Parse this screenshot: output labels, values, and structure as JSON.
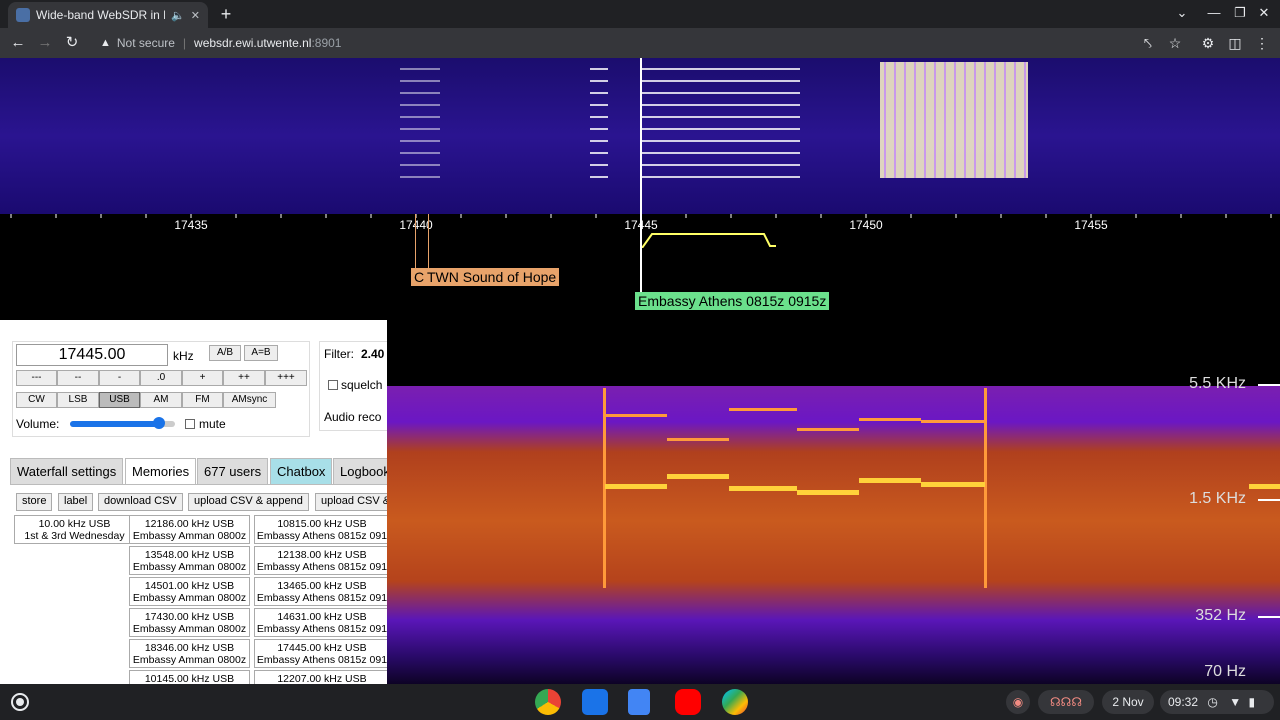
{
  "browser": {
    "tab_title": "Wide-band WebSDR in Ensch",
    "new_tab": "+",
    "security": "Not secure",
    "url_host": "websdr.ewi.utwente.nl",
    "url_port": ":8901"
  },
  "scale": {
    "ticks": [
      "17435",
      "17440",
      "17445",
      "17450",
      "17455"
    ]
  },
  "stations": {
    "c_label": "C",
    "twn": "TWN Sound of Hope",
    "embassy": "Embassy Athens 0815z 0915z"
  },
  "controls": {
    "frequency": "17445.00",
    "unit": "kHz",
    "ab": "A/B",
    "a_eq_b": "A=B",
    "steps": [
      "---",
      "--",
      "-",
      ".0",
      "+",
      "++",
      "+++"
    ],
    "modes": [
      "CW",
      "LSB",
      "USB",
      "AM",
      "FM",
      "AMsync"
    ],
    "active_mode": "USB",
    "volume_label": "Volume:",
    "volume_level": 0.85,
    "mute": "mute",
    "filter_label": "Filter:",
    "filter_value": "2.40",
    "squelch": "squelch",
    "audio_rec": "Audio reco"
  },
  "tabs": [
    "Waterfall settings",
    "Memories",
    "677 users",
    "Chatbox",
    "Logbook"
  ],
  "memory_buttons": [
    "store",
    "label",
    "download CSV",
    "upload CSV & append",
    "upload CSV &"
  ],
  "memories": {
    "col1": [
      {
        "f": "10.00 kHz USB",
        "n": "1st & 3rd Wednesday"
      }
    ],
    "col2": [
      {
        "f": "12186.00 kHz USB",
        "n": "Embassy Amman 0800z"
      },
      {
        "f": "13548.00 kHz USB",
        "n": "Embassy Amman 0800z"
      },
      {
        "f": "14501.00 kHz USB",
        "n": "Embassy Amman 0800z"
      },
      {
        "f": "17430.00 kHz USB",
        "n": "Embassy Amman 0800z"
      },
      {
        "f": "18346.00 kHz USB",
        "n": "Embassy Amman 0800z"
      },
      {
        "f": "10145.00 kHz USB",
        "n": ""
      }
    ],
    "col3": [
      {
        "f": "10815.00 kHz USB",
        "n": "Embassy Athens 0815z 091"
      },
      {
        "f": "12138.00 kHz USB",
        "n": "Embassy Athens 0815z 091"
      },
      {
        "f": "13465.00 kHz USB",
        "n": "Embassy Athens 0815z 091"
      },
      {
        "f": "14631.00 kHz USB",
        "n": "Embassy Athens 0815z 091"
      },
      {
        "f": "17445.00 kHz USB",
        "n": "Embassy Athens 0815z 091"
      },
      {
        "f": "12207.00 kHz USB",
        "n": ""
      }
    ]
  },
  "spectrogram": {
    "labels": [
      "5.5 KHz",
      "1.5 KHz",
      "352 Hz",
      "70 Hz"
    ]
  },
  "shelf": {
    "date": "2 Nov",
    "time": "09:32"
  }
}
